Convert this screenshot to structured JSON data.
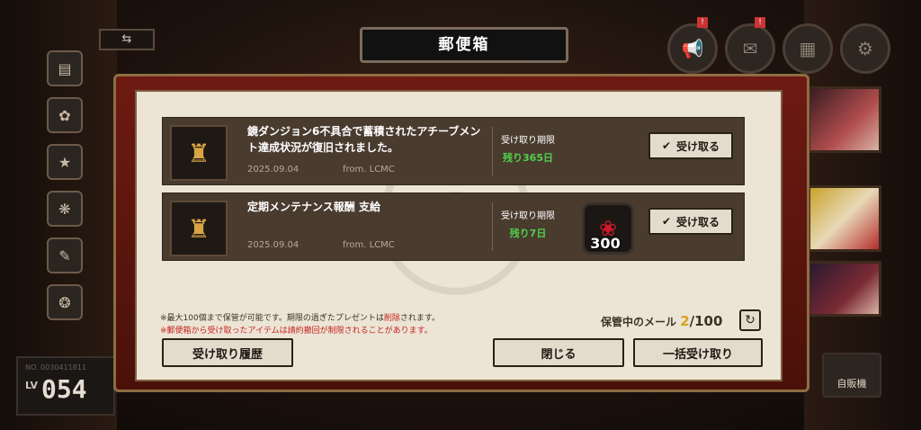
{
  "header": {
    "title": "郵便箱"
  },
  "top_icons": [
    {
      "name": "megaphone",
      "icon": "📢",
      "badge": "!"
    },
    {
      "name": "mail",
      "icon": "✉",
      "badge": "!"
    },
    {
      "name": "calendar",
      "icon": "▦",
      "badge": ""
    },
    {
      "name": "settings",
      "icon": "⚙",
      "badge": ""
    }
  ],
  "thumb_badge": "!",
  "mails": [
    {
      "title": "鏡ダンジョン6不具合で蓄積されたアチーブメント達成状況が復旧されました。",
      "date": "2025.09.04",
      "from": "from. LCMC",
      "limit_label": "受け取り期限",
      "limit_value": "残り365日",
      "button": "受け取る",
      "reward_count": ""
    },
    {
      "title": "定期メンテナンス報酬 支給",
      "date": "2025.09.04",
      "from": "from. LCMC",
      "limit_label": "受け取り期限",
      "limit_value": "残り7日",
      "button": "受け取る",
      "reward_count": "300"
    }
  ],
  "notes": {
    "line1_a": "※最大100個まで保管が可能です。期限の過ぎたプレゼントは",
    "line1_red": "削除",
    "line1_b": "されます。",
    "line2": "※郵便箱から受け取ったアイテムは請約撤回が制限されることがあります。"
  },
  "storage": {
    "label": "保管中のメール",
    "current": "2",
    "max": "/100"
  },
  "buttons": {
    "history": "受け取り履歴",
    "close": "閉じる",
    "receive_all": "一括受け取り"
  },
  "player": {
    "id": "NO. 0030411811",
    "lv_label": "LV",
    "level": "054"
  },
  "vending_label": "自販機",
  "swap_icon": "⇆",
  "colors": {
    "accent_green": "#4fd14a",
    "storage_gold": "#d8a21b",
    "warning_red": "#c7221d"
  }
}
